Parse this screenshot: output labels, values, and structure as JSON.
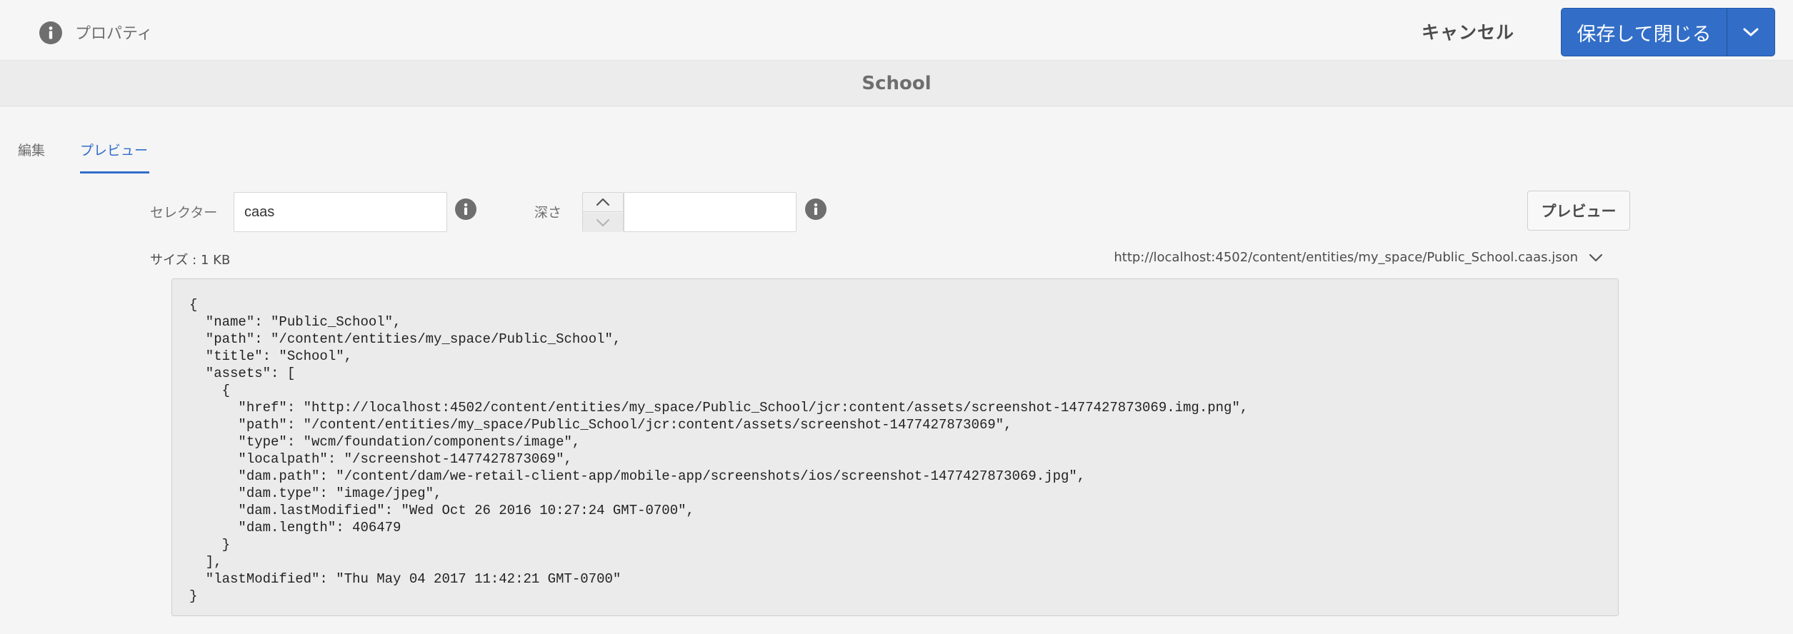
{
  "header": {
    "title": "プロパティ",
    "cancel_label": "キャンセル",
    "save_label": "保存して閉じる",
    "icons": {
      "info": "info-icon",
      "save_menu": "chevron-down-icon"
    }
  },
  "subheader": {
    "title": "School"
  },
  "tabs": [
    {
      "label": "編集",
      "active": false
    },
    {
      "label": "プレビュー",
      "active": true
    }
  ],
  "form": {
    "selector_label": "セレクター",
    "selector_value": "caas",
    "depth_label": "深さ",
    "depth_value": "",
    "preview_button": "プレビュー"
  },
  "result": {
    "size_text": "サイズ : 1 KB",
    "url": "http://localhost:4502/content/entities/my_space/Public_School.caas.json",
    "json_text": "{\n  \"name\": \"Public_School\",\n  \"path\": \"/content/entities/my_space/Public_School\",\n  \"title\": \"School\",\n  \"assets\": [\n    {\n      \"href\": \"http://localhost:4502/content/entities/my_space/Public_School/jcr:content/assets/screenshot-1477427873069.img.png\",\n      \"path\": \"/content/entities/my_space/Public_School/jcr:content/assets/screenshot-1477427873069\",\n      \"type\": \"wcm/foundation/components/image\",\n      \"localpath\": \"/screenshot-1477427873069\",\n      \"dam.path\": \"/content/dam/we-retail-client-app/mobile-app/screenshots/ios/screenshot-1477427873069.jpg\",\n      \"dam.type\": \"image/jpeg\",\n      \"dam.lastModified\": \"Wed Oct 26 2016 10:27:24 GMT-0700\",\n      \"dam.length\": 406479\n    }\n  ],\n  \"lastModified\": \"Thu May 04 2017 11:42:21 GMT-0700\"\n}"
  },
  "colors": {
    "accent": "#326ec8",
    "background": "#f5f5f5",
    "code_background": "#ebebeb"
  }
}
